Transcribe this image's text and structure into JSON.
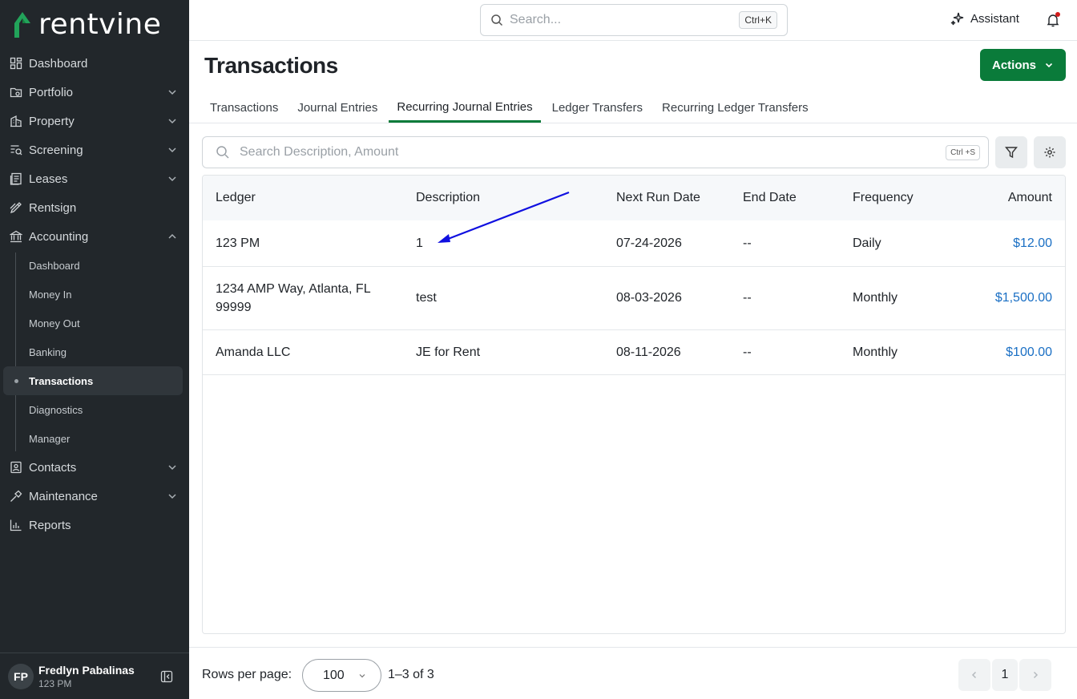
{
  "app": {
    "logo_text": "rentvine"
  },
  "sidebar": {
    "items": [
      {
        "label": "Dashboard",
        "icon": "dashboard-icon",
        "has_chevron": false
      },
      {
        "label": "Portfolio",
        "icon": "portfolio-icon",
        "has_chevron": true
      },
      {
        "label": "Property",
        "icon": "property-icon",
        "has_chevron": true
      },
      {
        "label": "Screening",
        "icon": "screening-icon",
        "has_chevron": true
      },
      {
        "label": "Leases",
        "icon": "leases-icon",
        "has_chevron": true
      },
      {
        "label": "Rentsign",
        "icon": "rentsign-icon",
        "has_chevron": false
      },
      {
        "label": "Accounting",
        "icon": "accounting-icon",
        "has_chevron": true,
        "expanded": true
      }
    ],
    "accounting_sub": [
      {
        "label": "Dashboard"
      },
      {
        "label": "Money In"
      },
      {
        "label": "Money Out"
      },
      {
        "label": "Banking"
      },
      {
        "label": "Transactions",
        "active": true
      },
      {
        "label": "Diagnostics"
      },
      {
        "label": "Manager"
      }
    ],
    "items_after": [
      {
        "label": "Contacts",
        "icon": "contacts-icon",
        "has_chevron": true
      },
      {
        "label": "Maintenance",
        "icon": "maintenance-icon",
        "has_chevron": true
      },
      {
        "label": "Reports",
        "icon": "reports-icon",
        "has_chevron": false
      }
    ],
    "user": {
      "initials": "FP",
      "name": "Fredlyn Pabalinas",
      "sub": "123 PM"
    }
  },
  "topbar": {
    "search_placeholder": "Search...",
    "search_shortcut": "Ctrl+K",
    "assistant_label": "Assistant"
  },
  "header": {
    "title": "Transactions",
    "actions_label": "Actions"
  },
  "tabs": [
    {
      "label": "Transactions",
      "active": false
    },
    {
      "label": "Journal Entries",
      "active": false
    },
    {
      "label": "Recurring Journal Entries",
      "active": true
    },
    {
      "label": "Ledger Transfers",
      "active": false
    },
    {
      "label": "Recurring Ledger Transfers",
      "active": false
    }
  ],
  "filter": {
    "search_placeholder": "Search Description, Amount",
    "shortcut": "Ctrl +S"
  },
  "table": {
    "columns": [
      "Ledger",
      "Description",
      "Next Run Date",
      "End Date",
      "Frequency",
      "Amount"
    ],
    "rows": [
      {
        "ledger": "123 PM",
        "description": "1",
        "next_run": "07-24-2026",
        "end_date": "--",
        "frequency": "Daily",
        "amount": "$12.00"
      },
      {
        "ledger": "1234 AMP Way, Atlanta, FL 99999",
        "description": "test",
        "next_run": "08-03-2026",
        "end_date": "--",
        "frequency": "Monthly",
        "amount": "$1,500.00"
      },
      {
        "ledger": "Amanda LLC",
        "description": "JE for Rent",
        "next_run": "08-11-2026",
        "end_date": "--",
        "frequency": "Monthly",
        "amount": "$100.00"
      }
    ]
  },
  "footer": {
    "rows_label": "Rows per page:",
    "rows_value": "100",
    "range": "1–3 of 3",
    "page": "1"
  },
  "colors": {
    "sidebar_bg": "#22272b",
    "brand_green": "#0a7b3a",
    "link_blue": "#1a6fc4",
    "annotation_arrow": "#1010e0"
  }
}
